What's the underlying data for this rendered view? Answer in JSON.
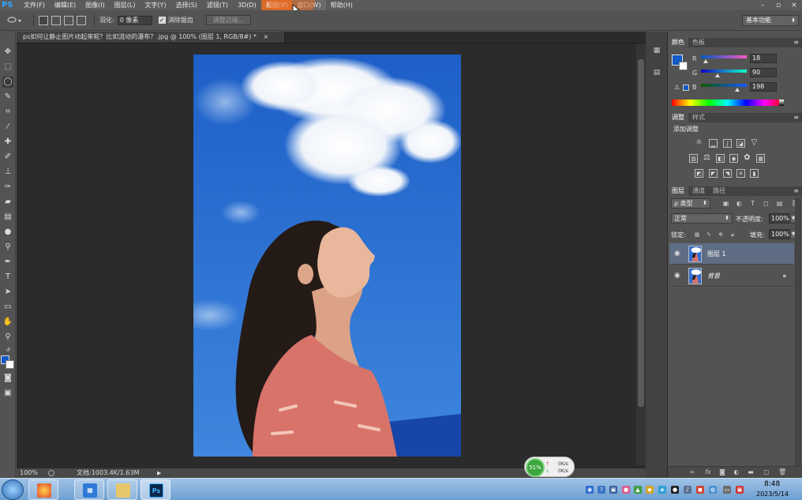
{
  "app": {
    "logo": "PS",
    "menu": [
      "文件(F)",
      "编辑(E)",
      "图像(I)",
      "图层(L)",
      "文字(Y)",
      "选择(S)",
      "滤镜(T)",
      "3D(D)",
      "视图(V)",
      "窗口(W)",
      "帮助(H)"
    ],
    "window_controls": [
      "–",
      "▫",
      "×"
    ]
  },
  "options_bar": {
    "feather_label": "羽化:",
    "feather_value": "0 像素",
    "antialias_label": "消除锯齿",
    "refine_edge_label": "调整边缘...",
    "workspace": "基本功能"
  },
  "document": {
    "tab_title": "ps如何让静止图片动起来呢？比如流动的瀑布？.jpg @ 100% (图层 1, RGB/8#) *",
    "tab_close": "×"
  },
  "statusbar": {
    "zoom": "100%",
    "doc_size": "文档:1003.4K/1.63M",
    "arrow": "▶"
  },
  "color_panel": {
    "tabs": [
      "颜色",
      "色板"
    ],
    "fg_color": "#125ac6",
    "bg_color": "#ffffff",
    "channels": [
      {
        "label": "R",
        "value": "18",
        "fraction": 0.07
      },
      {
        "label": "G",
        "value": "90",
        "fraction": 0.35
      },
      {
        "label": "B",
        "value": "198",
        "fraction": 0.78
      }
    ],
    "warning_glyph": "⚠"
  },
  "adjustments_panel": {
    "tabs": [
      "调整",
      "样式"
    ],
    "title": "添加调整"
  },
  "layers_panel": {
    "tabs": [
      "图层",
      "通道",
      "路径"
    ],
    "kind_filter": "ρ 类型",
    "blend_mode": "正常",
    "opacity_label": "不透明度:",
    "opacity_value": "100%",
    "lock_label": "锁定:",
    "fill_label": "填充:",
    "fill_value": "100%",
    "layers": [
      {
        "name": "图层 1",
        "selected": true,
        "locked": false
      },
      {
        "name": "背景",
        "selected": false,
        "locked": true
      }
    ]
  },
  "net_widget": {
    "percent": "51%",
    "up": "0K/s",
    "down": "0K/s"
  },
  "taskbar": {
    "time": "8:48",
    "date": "2023/5/14",
    "ps_label": "Ps"
  },
  "colors": {
    "accent_menu": "#d86b2a",
    "layer_selected": "#5e6d83",
    "sky_top": "#1d5fc7",
    "sky_bottom": "#3e86de"
  }
}
